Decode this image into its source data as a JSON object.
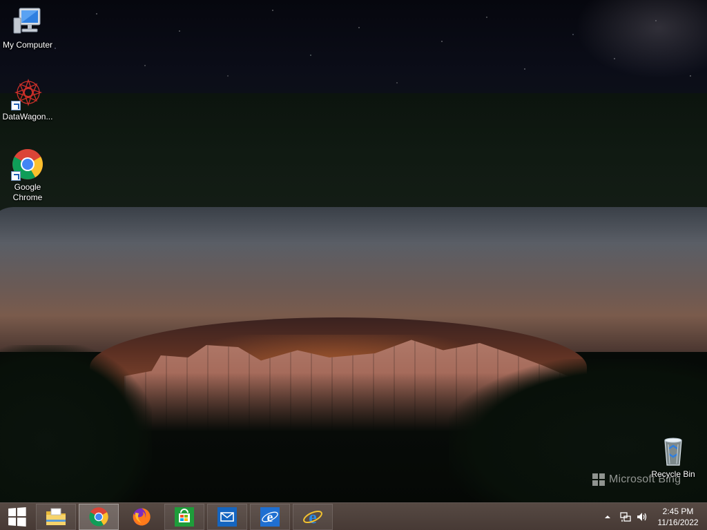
{
  "desktop": {
    "icons": [
      {
        "label": "My Computer",
        "icon": "computer-icon"
      },
      {
        "label": "DataWagon...",
        "icon": "datawagon-icon"
      },
      {
        "label": "Google Chrome",
        "icon": "chrome-icon"
      },
      {
        "label": "Recycle Bin",
        "icon": "recycle-bin-icon"
      }
    ],
    "watermark": "Microsoft Bing"
  },
  "taskbar": {
    "pinned": [
      {
        "name": "File Explorer",
        "icon": "file-explorer-icon",
        "state": "plain"
      },
      {
        "name": "Google Chrome",
        "icon": "chrome-icon",
        "state": "active"
      },
      {
        "name": "Firefox",
        "icon": "firefox-icon",
        "state": "none"
      },
      {
        "name": "Store",
        "icon": "store-icon",
        "state": "plain"
      },
      {
        "name": "Mail",
        "icon": "mail-icon",
        "state": "plain"
      },
      {
        "name": "Internet Explorer",
        "icon": "ie-icon",
        "state": "plain"
      },
      {
        "name": "Internet Explorer",
        "icon": "ie-icon",
        "state": "plain"
      }
    ],
    "clock": {
      "time": "2:45 PM",
      "date": "11/16/2022"
    },
    "colors": {
      "accent": "#0078d7",
      "store_green": "#1e9d3a",
      "mail_blue": "#1565c0"
    }
  }
}
